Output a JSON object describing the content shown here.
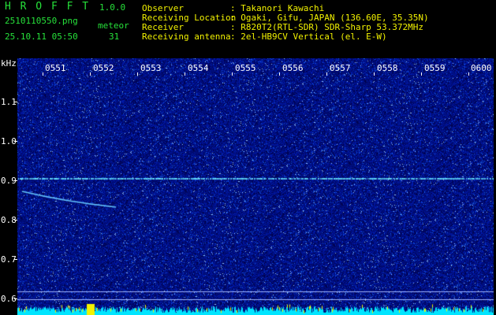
{
  "app": {
    "title": "H R O F F T",
    "version": "1.0.0",
    "filename": "2510110550.png",
    "datetime": "25.10.11 05:50",
    "meteor_label": "meteor",
    "meteor_count": "31"
  },
  "info": [
    {
      "label": "Observer",
      "value": ": Takanori Kawachi"
    },
    {
      "label": "Receiving Location",
      "value": ": Ogaki, Gifu, JAPAN (136.60E, 35.35N)"
    },
    {
      "label": "Receiver",
      "value": ": R820T2(RTL-SDR) SDR-Sharp 53.372MHz"
    },
    {
      "label": "Receiving antenna",
      "value": ": 2el-HB9CV Vertical (el. E-W)"
    }
  ],
  "axes": {
    "y_unit": "kHz",
    "y_ticks": [
      "1.1",
      "1.0",
      "0.9",
      "0.8",
      "0.7",
      "0.6"
    ],
    "x_ticks": [
      "0551",
      "0552",
      "0553",
      "0554",
      "0555",
      "0556",
      "0557",
      "0558",
      "0559",
      "0600"
    ]
  },
  "colors": {
    "background": "#000000",
    "noise_base": "#0a1a7a",
    "trace": "#66e6ff",
    "bar_cyan": "#00e5ff",
    "bar_yellow": "#f2f200"
  }
}
